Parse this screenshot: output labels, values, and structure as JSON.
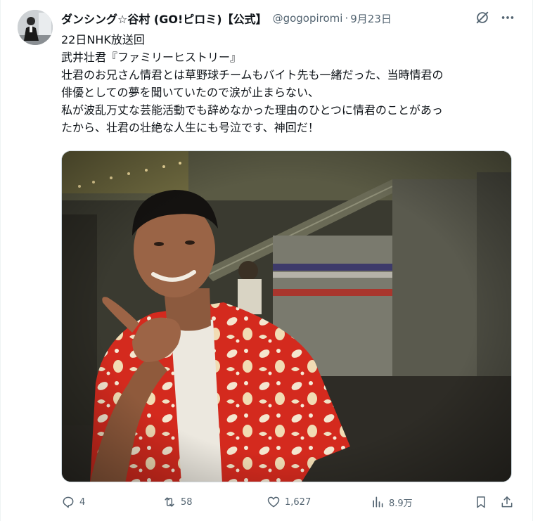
{
  "post": {
    "author": {
      "display_name": "ダンシング☆谷村 (GO!ピロミ)【公式】",
      "handle": "@gogopiromi",
      "separator": "·",
      "date": "9月23日"
    },
    "text_lines": [
      "22日NHK放送回",
      "武井壮君『ファミリーヒストリー』",
      "壮君のお兄さん情君とは草野球チームもバイト先も一緒だった、当時情君の",
      "俳優としての夢を聞いていたので涙が止まらない、",
      "私が波乱万丈な芸能活動でも辞めなかった理由のひとつに情君のことがあっ",
      "たから、壮君の壮絶な人生にも号泣です、神回だ！"
    ],
    "actions": {
      "reply_count": "4",
      "repost_count": "58",
      "like_count": "1,627",
      "views_count": "8.9万"
    }
  },
  "icons": {
    "grok": "slash-circle-icon",
    "more": "more-dots-icon",
    "reply": "reply-icon",
    "repost": "repost-icon",
    "like": "heart-icon",
    "views": "bar-chart-icon",
    "bookmark": "bookmark-icon",
    "share": "share-icon"
  },
  "colors": {
    "text": "#0f1419",
    "secondary": "#536471",
    "border": "#cfd9de",
    "shirt": "#d42a1e"
  }
}
